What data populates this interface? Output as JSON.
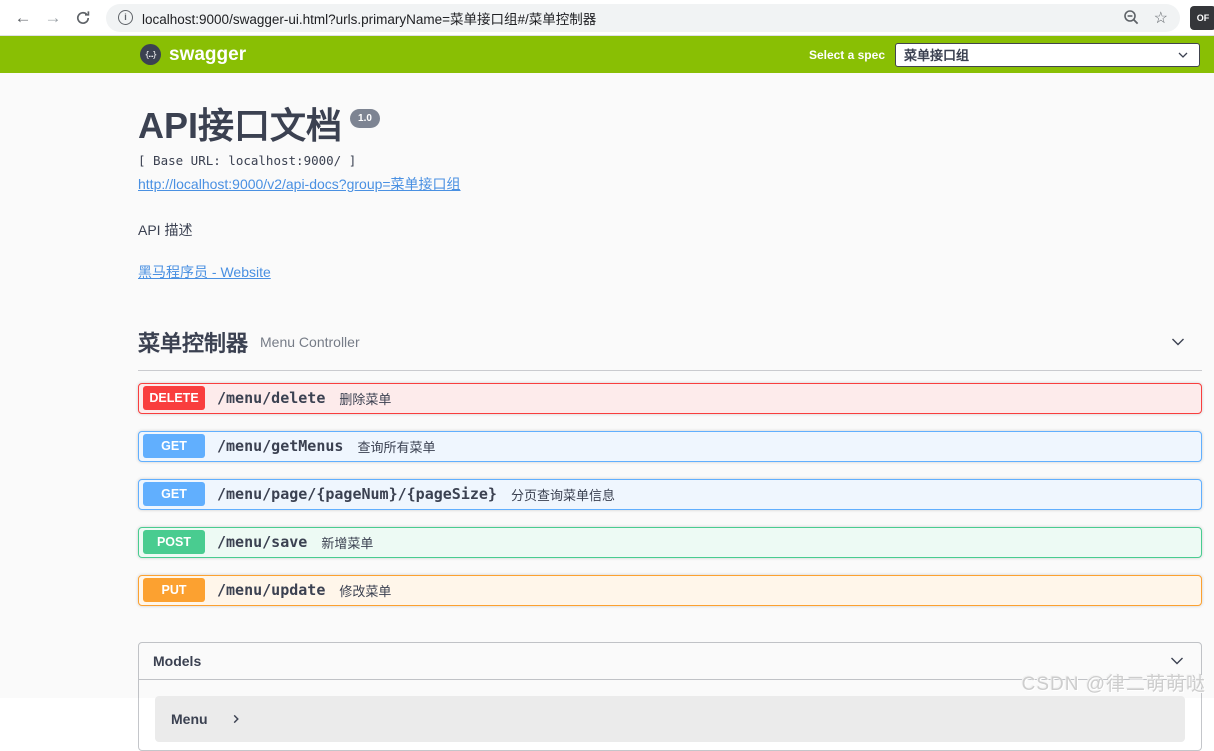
{
  "browser": {
    "url": "localhost:9000/swagger-ui.html?urls.primaryName=菜单接口组#/菜单控制器",
    "extension_badge": "OF"
  },
  "header": {
    "brand_color": "#89bf04",
    "logo_text": "swagger",
    "logo_glyph": "{…}",
    "select_label": "Select a spec",
    "selected_spec": "菜单接口组"
  },
  "info": {
    "title": "API接口文档",
    "version": "1.0",
    "base_url_line": "[ Base URL: localhost:9000/ ]",
    "spec_link": "http://localhost:9000/v2/api-docs?group=菜单接口组",
    "description": "API 描述",
    "website_link": "黑马程序员 - Website",
    "link_color": "#4990e2"
  },
  "tag_section": {
    "title": "菜单控制器",
    "subtitle": "Menu Controller"
  },
  "operations": [
    {
      "method": "DELETE",
      "path": "/menu/delete",
      "summary": "删除菜单",
      "color": "#f93e3e",
      "bg": "#fdebeb"
    },
    {
      "method": "GET",
      "path": "/menu/getMenus",
      "summary": "查询所有菜单",
      "color": "#61affe",
      "bg": "#eff6fe"
    },
    {
      "method": "GET",
      "path": "/menu/page/{pageNum}/{pageSize}",
      "summary": "分页查询菜单信息",
      "color": "#61affe",
      "bg": "#eff6fe"
    },
    {
      "method": "POST",
      "path": "/menu/save",
      "summary": "新增菜单",
      "color": "#49cc90",
      "bg": "#edfaf4"
    },
    {
      "method": "PUT",
      "path": "/menu/update",
      "summary": "修改菜单",
      "color": "#fca130",
      "bg": "#fff6ea"
    }
  ],
  "models": {
    "title": "Models",
    "items": [
      "Menu"
    ]
  },
  "watermark": "CSDN @律二萌萌哒"
}
